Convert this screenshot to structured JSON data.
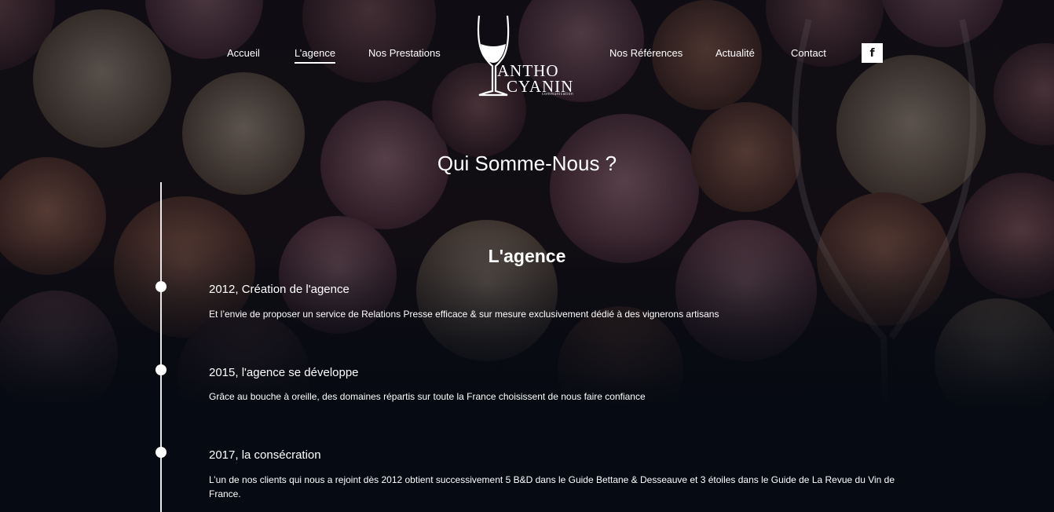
{
  "nav": {
    "items": [
      {
        "label": "Accueil",
        "active": false
      },
      {
        "label": "L’agence",
        "active": true
      },
      {
        "label": "Nos Prestations",
        "active": false
      },
      {
        "label": "Nos Références",
        "active": false
      },
      {
        "label": "Actualité",
        "active": false
      },
      {
        "label": "Contact",
        "active": false
      }
    ],
    "facebook_glyph": "f"
  },
  "logo": {
    "line1": "ANTHO",
    "line2": "CYANIN",
    "tagline": "communication"
  },
  "page_title": "Qui Somme-Nous ?",
  "section_title": "L'agence",
  "timeline": [
    {
      "title": "2012, Création de l'agence",
      "text": "Et l’envie de proposer un service de Relations Presse efficace & sur mesure exclusivement dédié à des vignerons artisans"
    },
    {
      "title": "2015, l'agence se développe",
      "text": "Grâce au bouche à oreille, des domaines répartis sur toute la France choisissent de nous faire confiance"
    },
    {
      "title": "2017, la consécration",
      "text": "L’un de nos clients qui nous a rejoint dès 2012 obtient successivement 5 B&D dans le Guide Bettane & Desseauve et 3 étoiles dans le Guide de La Revue du Vin de France."
    }
  ],
  "colors": {
    "background": "#060a12",
    "text": "#ffffff",
    "cork_dark": "#4a2a2e",
    "cork_light": "#8a6a5a"
  },
  "icons": [
    "facebook-icon",
    "wine-glass-icon",
    "timeline-dot-icon"
  ]
}
